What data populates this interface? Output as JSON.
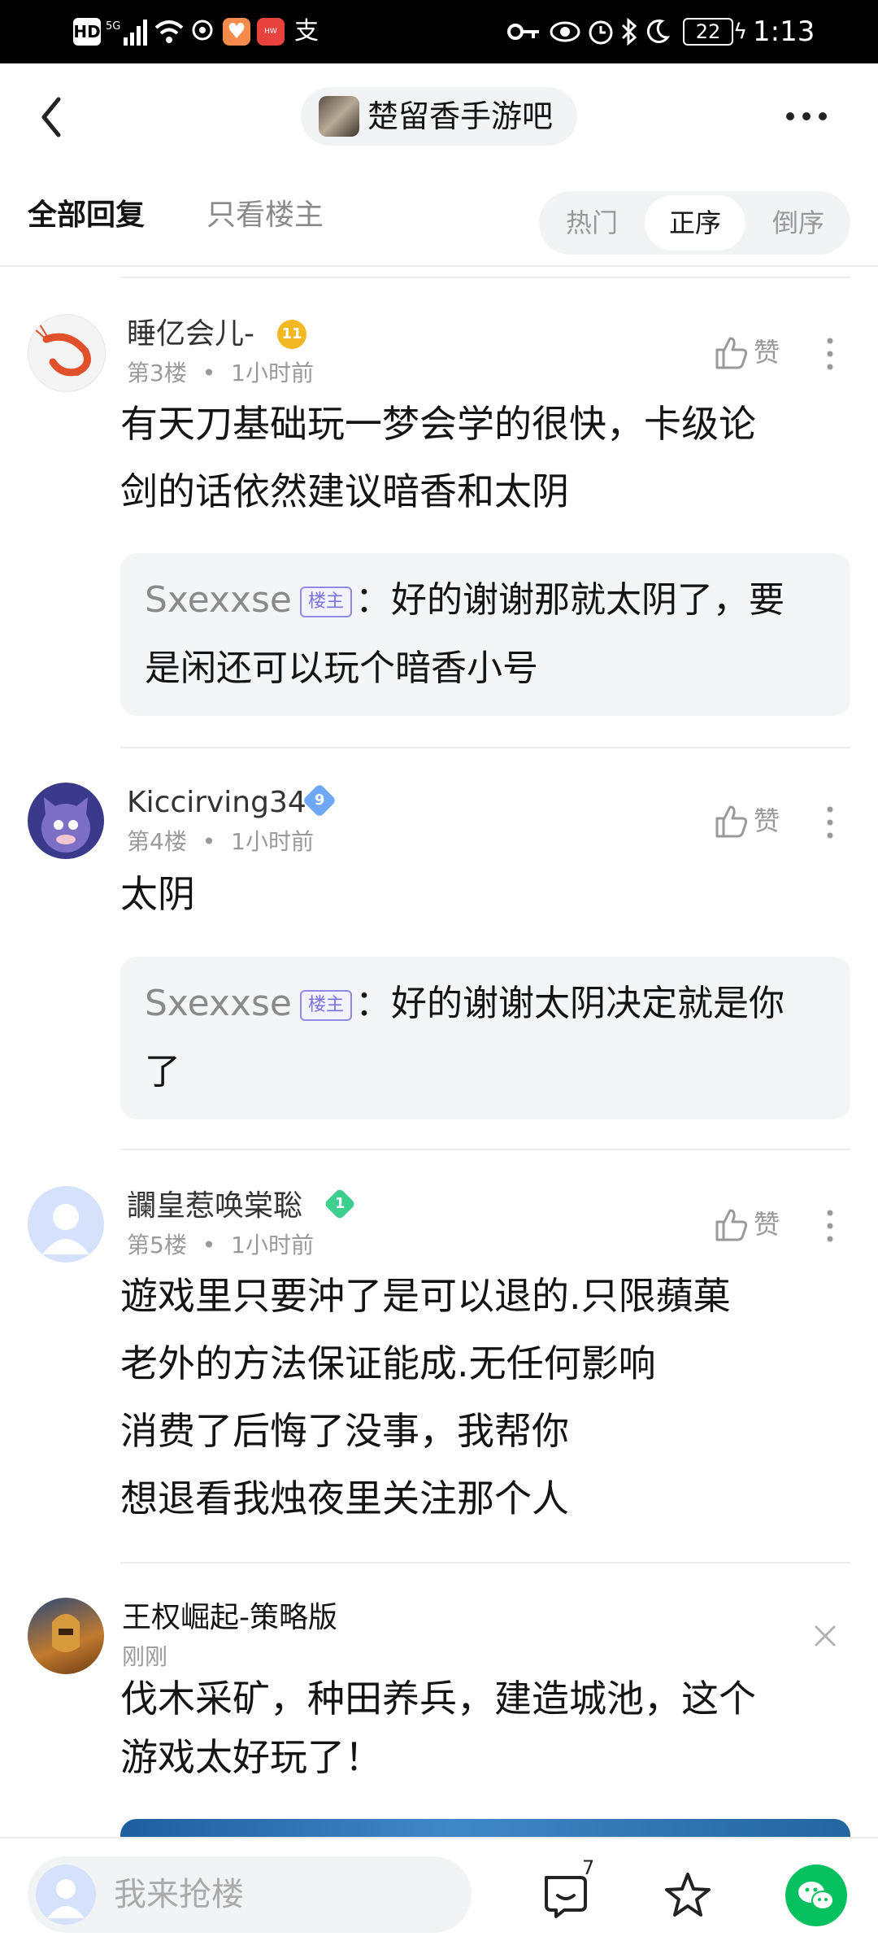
{
  "status_bar": {
    "left_icons": [
      "hd-icon",
      "5g-signal-icon",
      "wifi-icon",
      "location-icon",
      "health-app-icon",
      "huawei-app-icon",
      "alipay-icon"
    ],
    "battery": "22",
    "time": "1:13"
  },
  "header": {
    "back_icon": "chevron-left-icon",
    "forum_name": "楚留香手游吧",
    "more_icon": "more-horizontal-icon"
  },
  "tabs": {
    "all_replies": "全部回复",
    "owner_only": "只看楼主",
    "sort_options": [
      "热门",
      "正序",
      "倒序"
    ],
    "sort_selected": "正序"
  },
  "posts": [
    {
      "username": "睡亿会儿-",
      "level": "11",
      "floor": "第3楼",
      "time": "1小时前",
      "like_label": "赞",
      "lines": [
        "有天刀基础玩一梦会学的很快，卡级论",
        "剑的话依然建议暗香和太阴"
      ],
      "reply": {
        "user": "Sxexxse",
        "badge": "楼主",
        "colon": "：",
        "line1": "好的谢谢那就太阴了，要",
        "line2": "是闲还可以玩个暗香小号"
      }
    },
    {
      "username": "Kiccirving34",
      "level": "9",
      "floor": "第4楼",
      "time": "1小时前",
      "like_label": "赞",
      "lines": [
        "太阴"
      ],
      "reply": {
        "user": "Sxexxse",
        "badge": "楼主",
        "colon": "：",
        "line1": "好的谢谢太阴决定就是你",
        "line2": "了"
      }
    },
    {
      "username": "讕皇惹唤棠聡",
      "level": "1",
      "floor": "第5楼",
      "time": "1小时前",
      "like_label": "赞",
      "lines": [
        "遊戏里只要沖了是可以退的.只限蘋菓",
        "老外的方法保证能成.无任何影响",
        "消费了后悔了没事，我帮你",
        "想退看我烛夜里关注那个人"
      ]
    }
  ],
  "ad": {
    "name": "王权崛起-策略版",
    "time": "刚刚",
    "lines": [
      "伐木采矿，种田养兵，建造城池，这个",
      "游戏太好玩了！"
    ],
    "close_icon": "close-icon"
  },
  "bottom_bar": {
    "placeholder": "我来抢楼",
    "comment_count": "7",
    "icons": [
      "comment-icon",
      "star-icon",
      "wechat-share-icon"
    ]
  },
  "colors": {
    "accent_green": "#07c160",
    "level_gold": "#f2b824",
    "level_blue": "#6ea8f5",
    "level_green": "#3ecf8e",
    "owner_badge": "#7772e0"
  }
}
